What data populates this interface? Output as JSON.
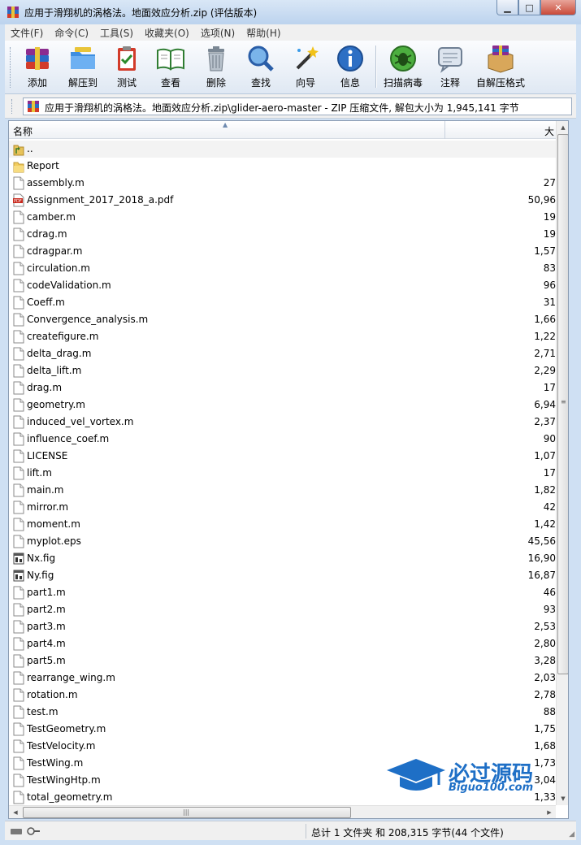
{
  "window": {
    "title": "应用于滑翔机的涡格法。地面效应分析.zip (评估版本)"
  },
  "menu": [
    "文件(F)",
    "命令(C)",
    "工具(S)",
    "收藏夹(O)",
    "选项(N)",
    "帮助(H)"
  ],
  "toolbar": {
    "add": "添加",
    "extract": "解压到",
    "test": "测试",
    "view": "查看",
    "delete": "删除",
    "find": "查找",
    "wizard": "向导",
    "info": "信息",
    "scan": "扫描病毒",
    "comment": "注释",
    "sfx": "自解压格式"
  },
  "address": {
    "path": "应用于滑翔机的涡格法。地面效应分析.zip\\glider-aero-master - ZIP 压缩文件, 解包大小为 1,945,141 字节"
  },
  "list": {
    "col_name": "名称",
    "col_size": "大",
    "files": [
      {
        "name": "..",
        "size": "",
        "type": "up"
      },
      {
        "name": "Report",
        "size": "",
        "type": "folder"
      },
      {
        "name": "assembly.m",
        "size": "27",
        "type": "file"
      },
      {
        "name": "Assignment_2017_2018_a.pdf",
        "size": "50,96",
        "type": "pdf"
      },
      {
        "name": "camber.m",
        "size": "19",
        "type": "file"
      },
      {
        "name": "cdrag.m",
        "size": "19",
        "type": "file"
      },
      {
        "name": "cdragpar.m",
        "size": "1,57",
        "type": "file"
      },
      {
        "name": "circulation.m",
        "size": "83",
        "type": "file"
      },
      {
        "name": "codeValidation.m",
        "size": "96",
        "type": "file"
      },
      {
        "name": "Coeff.m",
        "size": "31",
        "type": "file"
      },
      {
        "name": "Convergence_analysis.m",
        "size": "1,66",
        "type": "file"
      },
      {
        "name": "createfigure.m",
        "size": "1,22",
        "type": "file"
      },
      {
        "name": "delta_drag.m",
        "size": "2,71",
        "type": "file"
      },
      {
        "name": "delta_lift.m",
        "size": "2,29",
        "type": "file"
      },
      {
        "name": "drag.m",
        "size": "17",
        "type": "file"
      },
      {
        "name": "geometry.m",
        "size": "6,94",
        "type": "file"
      },
      {
        "name": "induced_vel_vortex.m",
        "size": "2,37",
        "type": "file"
      },
      {
        "name": "influence_coef.m",
        "size": "90",
        "type": "file"
      },
      {
        "name": "LICENSE",
        "size": "1,07",
        "type": "file"
      },
      {
        "name": "lift.m",
        "size": "17",
        "type": "file"
      },
      {
        "name": "main.m",
        "size": "1,82",
        "type": "file"
      },
      {
        "name": "mirror.m",
        "size": "42",
        "type": "file"
      },
      {
        "name": "moment.m",
        "size": "1,42",
        "type": "file"
      },
      {
        "name": "myplot.eps",
        "size": "45,56",
        "type": "file"
      },
      {
        "name": "Nx.fig",
        "size": "16,90",
        "type": "fig"
      },
      {
        "name": "Ny.fig",
        "size": "16,87",
        "type": "fig"
      },
      {
        "name": "part1.m",
        "size": "46",
        "type": "file"
      },
      {
        "name": "part2.m",
        "size": "93",
        "type": "file"
      },
      {
        "name": "part3.m",
        "size": "2,53",
        "type": "file"
      },
      {
        "name": "part4.m",
        "size": "2,80",
        "type": "file"
      },
      {
        "name": "part5.m",
        "size": "3,28",
        "type": "file"
      },
      {
        "name": "rearrange_wing.m",
        "size": "2,03",
        "type": "file"
      },
      {
        "name": "rotation.m",
        "size": "2,78",
        "type": "file"
      },
      {
        "name": "test.m",
        "size": "88",
        "type": "file"
      },
      {
        "name": "TestGeometry.m",
        "size": "1,75",
        "type": "file"
      },
      {
        "name": "TestVelocity.m",
        "size": "1,68",
        "type": "file"
      },
      {
        "name": "TestWing.m",
        "size": "1,73",
        "type": "file"
      },
      {
        "name": "TestWingHtp.m",
        "size": "3,04",
        "type": "file"
      },
      {
        "name": "total_geometry.m",
        "size": "1,33",
        "type": "file"
      }
    ]
  },
  "watermark": {
    "main": "必过源码",
    "sub": "Biguo100.com"
  },
  "status": {
    "summary": "总计 1 文件夹 和 208,315 字节(44 个文件)"
  }
}
